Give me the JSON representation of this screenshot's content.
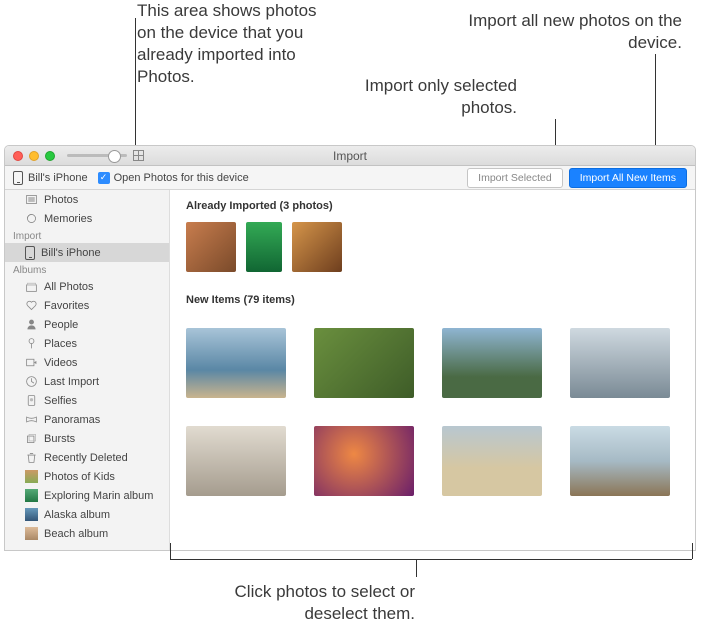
{
  "annotations": {
    "already": "This area shows photos on the device that you already imported into Photos.",
    "import_all": "Import all new photos on the device.",
    "import_sel": "Import only selected photos.",
    "click_select": "Click photos to select or deselect them."
  },
  "window": {
    "title": "Import"
  },
  "toolbar": {
    "device": "Bill's iPhone",
    "open_label": "Open Photos for this device",
    "open_checked": true,
    "import_selected": "Import Selected",
    "import_all": "Import All New Items"
  },
  "sidebar": {
    "library": [
      {
        "icon": "photos",
        "label": "Photos"
      },
      {
        "icon": "memories",
        "label": "Memories"
      }
    ],
    "import_head": "Import",
    "import_items": [
      {
        "icon": "device",
        "label": "Bill's iPhone",
        "selected": true
      }
    ],
    "albums_head": "Albums",
    "albums": [
      {
        "icon": "stack",
        "label": "All Photos"
      },
      {
        "icon": "heart",
        "label": "Favorites"
      },
      {
        "icon": "people",
        "label": "People"
      },
      {
        "icon": "pin",
        "label": "Places"
      },
      {
        "icon": "video",
        "label": "Videos"
      },
      {
        "icon": "clock",
        "label": "Last Import"
      },
      {
        "icon": "selfie",
        "label": "Selfies"
      },
      {
        "icon": "pano",
        "label": "Panoramas"
      },
      {
        "icon": "burst",
        "label": "Bursts"
      },
      {
        "icon": "trash",
        "label": "Recently Deleted"
      },
      {
        "icon": "album",
        "label": "Photos of Kids"
      },
      {
        "icon": "album",
        "label": "Exploring Marin album"
      },
      {
        "icon": "album",
        "label": "Alaska album"
      },
      {
        "icon": "album",
        "label": "Beach album"
      }
    ]
  },
  "content": {
    "already_head": "Already Imported (3 photos)",
    "already_thumbs": [
      "t1",
      "t2",
      "t3"
    ],
    "new_head": "New Items (79 items)",
    "new_thumbs": [
      "n1",
      "n2",
      "n3",
      "n4",
      "n5",
      "n6",
      "n7",
      "n8"
    ]
  }
}
